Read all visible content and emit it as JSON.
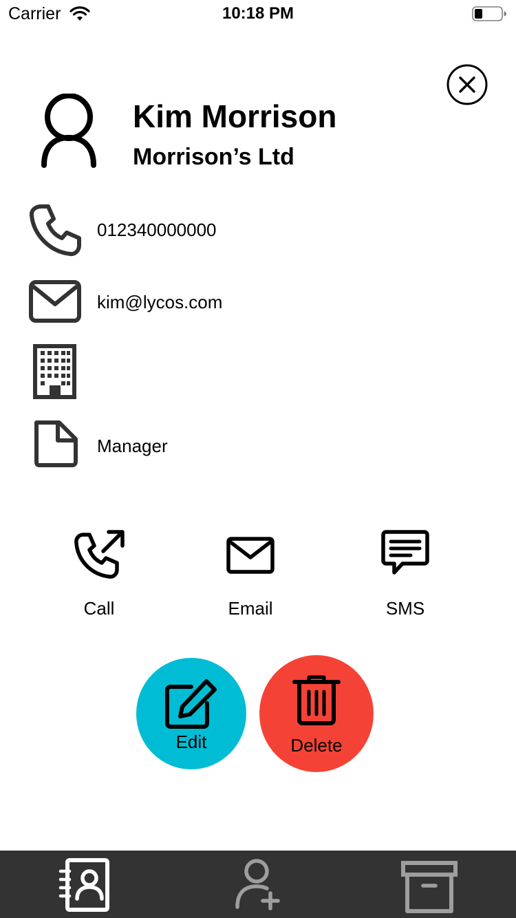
{
  "status_bar": {
    "carrier": "Carrier",
    "time": "10:18 PM"
  },
  "contact": {
    "name": "Kim Morrison",
    "company": "Morrison’s Ltd",
    "phone": "012340000000",
    "email": "kim@lycos.com",
    "address": "",
    "role": "Manager"
  },
  "actions": {
    "call_label": "Call",
    "email_label": "Email",
    "sms_label": "SMS"
  },
  "buttons": {
    "edit_label": "Edit",
    "delete_label": "Delete"
  },
  "tabs": [
    {
      "icon": "contacts-book-icon",
      "active": true
    },
    {
      "icon": "add-person-icon",
      "active": false
    },
    {
      "icon": "archive-box-icon",
      "active": false
    }
  ],
  "colors": {
    "edit": "#00bcd4",
    "delete": "#f44336",
    "tab_bar": "#333333",
    "tab_active": "#ffffff",
    "tab_inactive": "#9e9e9e"
  },
  "icons": {
    "close": "close-circle-icon",
    "avatar": "person-outline-icon",
    "phone": "phone-icon",
    "email": "envelope-icon",
    "address": "office-building-icon",
    "role": "document-icon",
    "call": "phone-outgoing-icon",
    "email_action": "envelope-icon",
    "sms": "chat-message-icon",
    "edit": "pencil-edit-icon",
    "delete": "trash-icon"
  }
}
